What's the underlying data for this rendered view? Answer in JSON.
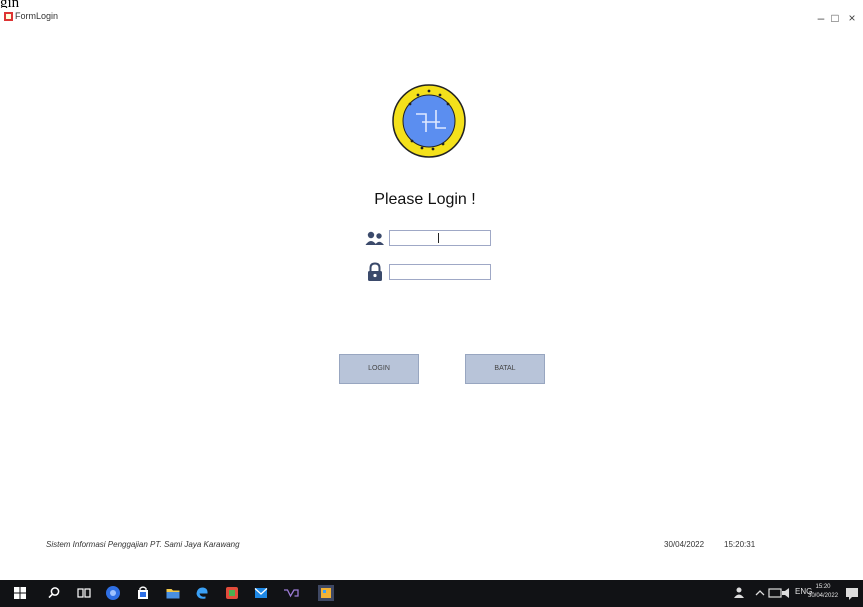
{
  "top_cut_text": "gin",
  "window": {
    "title": "FormLogin",
    "minimize": "–",
    "maximize": "□",
    "close": "×"
  },
  "logo": {
    "icon": "logo-emblem"
  },
  "heading": "Please Login !",
  "form": {
    "username_icon": "users-icon",
    "username_value": "",
    "password_icon": "lock-icon",
    "password_value": ""
  },
  "buttons": {
    "login": "LOGIN",
    "cancel": "BATAL"
  },
  "status": {
    "app_name": "Sistem Informasi Penggajian PT. Sami Jaya Karawang",
    "date": "30/04/2022",
    "time": "15:20:31"
  },
  "taskbar": {
    "tray_text": "ENG",
    "clock_time": "15:20",
    "clock_date": "30/04/2022"
  },
  "colors": {
    "logo_ring": "#f4e11b",
    "logo_center": "#5b8ef0",
    "button_bg": "#b8c4d9",
    "taskbar_bg": "#111215"
  }
}
